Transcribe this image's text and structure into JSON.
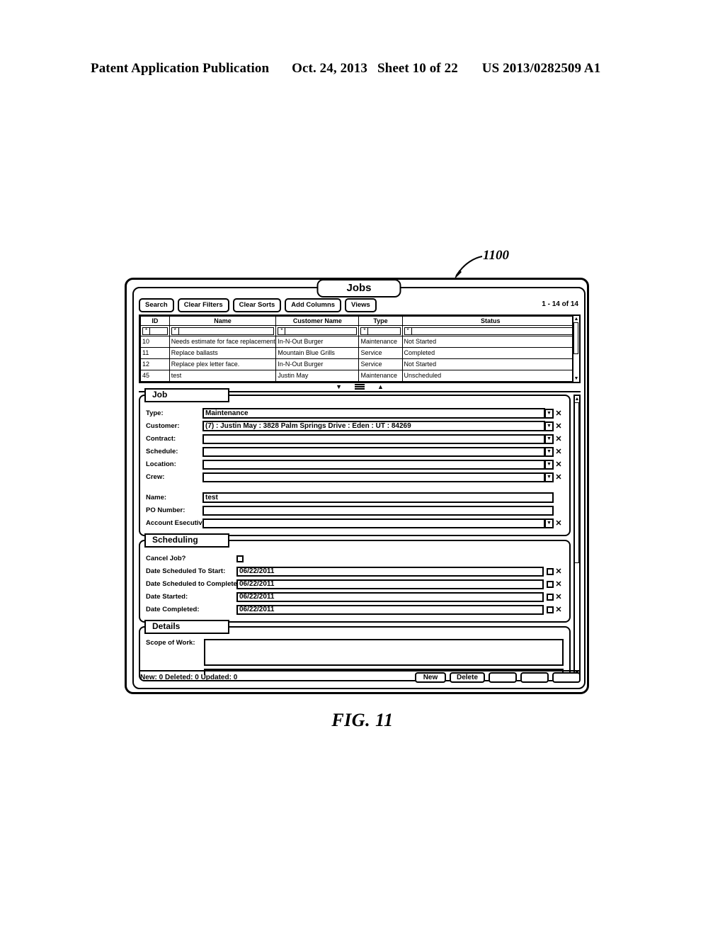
{
  "page_header": {
    "publication": "Patent Application Publication",
    "date": "Oct. 24, 2013",
    "sheet": "Sheet 10 of 22",
    "patent_number": "US 2013/0282509 A1"
  },
  "figure": {
    "caption": "FIG. 11",
    "reference_numeral": "1100"
  },
  "window": {
    "title": "Jobs",
    "record_count": "1 - 14 of 14"
  },
  "toolbar": {
    "buttons": [
      {
        "label": "Search",
        "name": "search-button"
      },
      {
        "label": "Clear Filters",
        "name": "clear-filters-button"
      },
      {
        "label": "Clear Sorts",
        "name": "clear-sorts-button"
      },
      {
        "label": "Add Columns",
        "name": "add-columns-button"
      },
      {
        "label": "Views",
        "name": "views-button"
      }
    ]
  },
  "grid": {
    "columns": [
      "ID",
      "Name",
      "Customer Name",
      "Type",
      "Status"
    ],
    "filter_placeholder": "",
    "filter_star": "*",
    "rows": [
      {
        "id": "10",
        "name": "Needs estimate for face replacement",
        "customer_name": "In-N-Out Burger",
        "type": "Maintenance",
        "status": "Not Started"
      },
      {
        "id": "11",
        "name": "Replace ballasts",
        "customer_name": "Mountain Blue Grills",
        "type": "Service",
        "status": "Completed"
      },
      {
        "id": "12",
        "name": "Replace plex letter face.",
        "customer_name": "In-N-Out Burger",
        "type": "Service",
        "status": "Not Started"
      },
      {
        "id": "45",
        "name": "test",
        "customer_name": "Justin May",
        "type": "Maintenance",
        "status": "Unscheduled"
      }
    ]
  },
  "splitter": {
    "collapse_icon": "▼",
    "grip_icon": "grip-lines",
    "expand_icon": "▲"
  },
  "job_section": {
    "title": "Job",
    "fields": {
      "type": {
        "label": "Type:",
        "value": "Maintenance"
      },
      "customer": {
        "label": "Customer:",
        "value": "(7) : Justin May : 3828 Palm Springs Drive : Eden : UT : 84269"
      },
      "contract": {
        "label": "Contract:",
        "value": ""
      },
      "schedule": {
        "label": "Schedule:",
        "value": ""
      },
      "location": {
        "label": "Location:",
        "value": ""
      },
      "crew": {
        "label": "Crew:",
        "value": ""
      },
      "name": {
        "label": "Name:",
        "value": "test"
      },
      "po_number": {
        "label": "PO Number:",
        "value": ""
      },
      "account_executive": {
        "label": "Account Esecutive:",
        "value": ""
      }
    }
  },
  "scheduling_section": {
    "title": "Scheduling",
    "fields": {
      "cancel_job": {
        "label": "Cancel Job?",
        "checked": false
      },
      "date_scheduled_to_start": {
        "label": "Date Scheduled To Start:",
        "value": "06/22/2011"
      },
      "date_scheduled_to_complete": {
        "label": "Date Scheduled to Complete:",
        "value": "06/22/2011"
      },
      "date_started": {
        "label": "Date Started:",
        "value": "06/22/2011"
      },
      "date_completed": {
        "label": "Date Completed:",
        "value": "06/22/2011"
      }
    }
  },
  "details_section": {
    "title": "Details",
    "fields": {
      "scope_of_work": {
        "label": "Scope of Work:",
        "value": ""
      }
    }
  },
  "status_bar": {
    "summary": "New: 0 Deleted: 0 Updated: 0",
    "buttons": [
      {
        "label": "New",
        "name": "new-record-button"
      },
      {
        "label": "Delete",
        "name": "delete-record-button"
      },
      {
        "label": "",
        "name": "unlabeled-button-1"
      },
      {
        "label": "",
        "name": "unlabeled-button-2"
      },
      {
        "label": "",
        "name": "unlabeled-button-3"
      }
    ]
  },
  "icons": {
    "dropdown_arrow": "▼",
    "clear_x": "✕",
    "scroll_up": "▲",
    "scroll_down": "▼"
  }
}
